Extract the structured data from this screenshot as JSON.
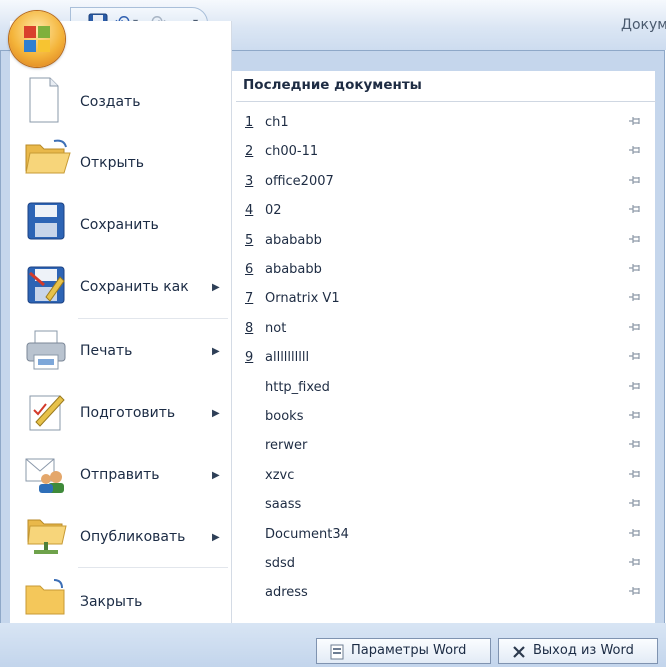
{
  "window": {
    "title": "Докум"
  },
  "quick_access": {
    "undo_label": "↶",
    "undo_dropdown": "▾",
    "redo_label": "↷",
    "customize_label": "▾"
  },
  "office_menu": {
    "items": [
      {
        "label": "Создать",
        "icon": "new-document-icon",
        "has_submenu": false
      },
      {
        "label": "Открыть",
        "icon": "open-folder-icon",
        "has_submenu": false
      },
      {
        "label": "Сохранить",
        "icon": "save-icon",
        "has_submenu": false
      },
      {
        "label": "Сохранить как",
        "icon": "save-as-icon",
        "has_submenu": true,
        "arrow": "▶"
      },
      {
        "label": "Печать",
        "icon": "printer-icon",
        "has_submenu": true,
        "arrow": "▶"
      },
      {
        "label": "Подготовить",
        "icon": "prepare-icon",
        "has_submenu": true,
        "arrow": "▶"
      },
      {
        "label": "Отправить",
        "icon": "send-icon",
        "has_submenu": true,
        "arrow": "▶"
      },
      {
        "label": "Опубликовать",
        "icon": "publish-icon",
        "has_submenu": true,
        "arrow": "▶"
      },
      {
        "label": "Закрыть",
        "icon": "close-folder-icon",
        "has_submenu": false
      }
    ]
  },
  "recent": {
    "header": "Последние документы",
    "documents": [
      {
        "num": "1",
        "name": "ch1"
      },
      {
        "num": "2",
        "name": "ch00-11"
      },
      {
        "num": "3",
        "name": "office2007"
      },
      {
        "num": "4",
        "name": "02"
      },
      {
        "num": "5",
        "name": "abababb"
      },
      {
        "num": "6",
        "name": "abababb"
      },
      {
        "num": "7",
        "name": "Ornatrix V1"
      },
      {
        "num": "8",
        "name": "not"
      },
      {
        "num": "9",
        "name": "allllllllll"
      },
      {
        "num": "",
        "name": "http_fixed"
      },
      {
        "num": "",
        "name": "books"
      },
      {
        "num": "",
        "name": "rerwer"
      },
      {
        "num": "",
        "name": "xzvc"
      },
      {
        "num": "",
        "name": "saass"
      },
      {
        "num": "",
        "name": "Document34"
      },
      {
        "num": "",
        "name": "sdsd"
      },
      {
        "num": "",
        "name": "adress"
      }
    ]
  },
  "footer": {
    "options_label": "Параметры Word",
    "exit_label": "Выход из Word"
  },
  "colors": {
    "frame": "#c5d6ec",
    "titlebar": "#dbe6f4",
    "accent": "#f4b43a"
  }
}
